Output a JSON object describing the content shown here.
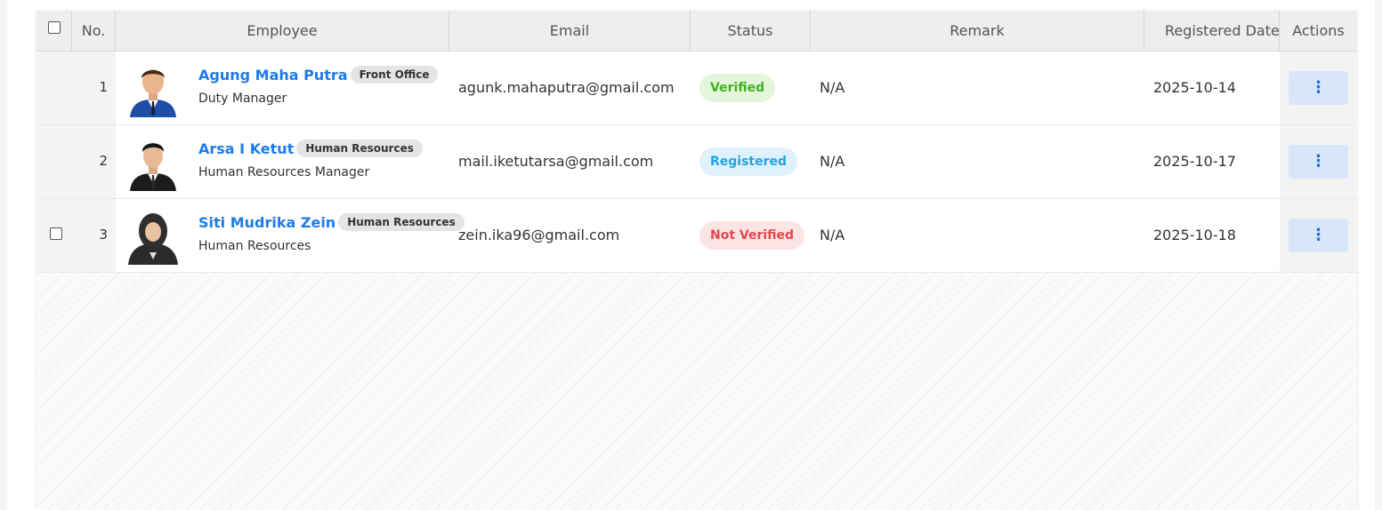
{
  "table": {
    "columns": [
      "No.",
      "Employee",
      "Email",
      "Status",
      "Remark",
      "Registered Date",
      "Actions"
    ],
    "rows": [
      {
        "no": "1",
        "name": "Agung Maha Putra",
        "department": "Front Office",
        "title": "Duty Manager",
        "email": "agunk.mahaputra@gmail.com",
        "status": "Verified",
        "remark": "N/A",
        "registered_date": "2025-10-14",
        "actions_icon": "⋮"
      },
      {
        "no": "2",
        "name": "Arsa I Ketut",
        "department": "Human Resources",
        "title": "Human Resources Manager",
        "email": "mail.iketutarsa@gmail.com",
        "status": "Registered",
        "remark": "N/A",
        "registered_date": "2025-10-17",
        "actions_icon": "⋮"
      },
      {
        "no": "3",
        "name": "Siti Mudrika Zein",
        "department": "Human Resources",
        "title": "Human Resources",
        "email": "zein.ika96@gmail.com",
        "status": "Not Verified",
        "remark": "N/A",
        "registered_date": "2025-10-18",
        "actions_icon": "⋮"
      }
    ]
  },
  "colors": {
    "link": "#1e7ce8",
    "verified_bg": "#e3f6dc",
    "verified_fg": "#43b31f",
    "registered_bg": "#dff1fc",
    "registered_fg": "#23a3e0",
    "not_verified_bg": "#fde4e4",
    "not_verified_fg": "#e5484d",
    "action_bg": "#d7e6f8"
  }
}
